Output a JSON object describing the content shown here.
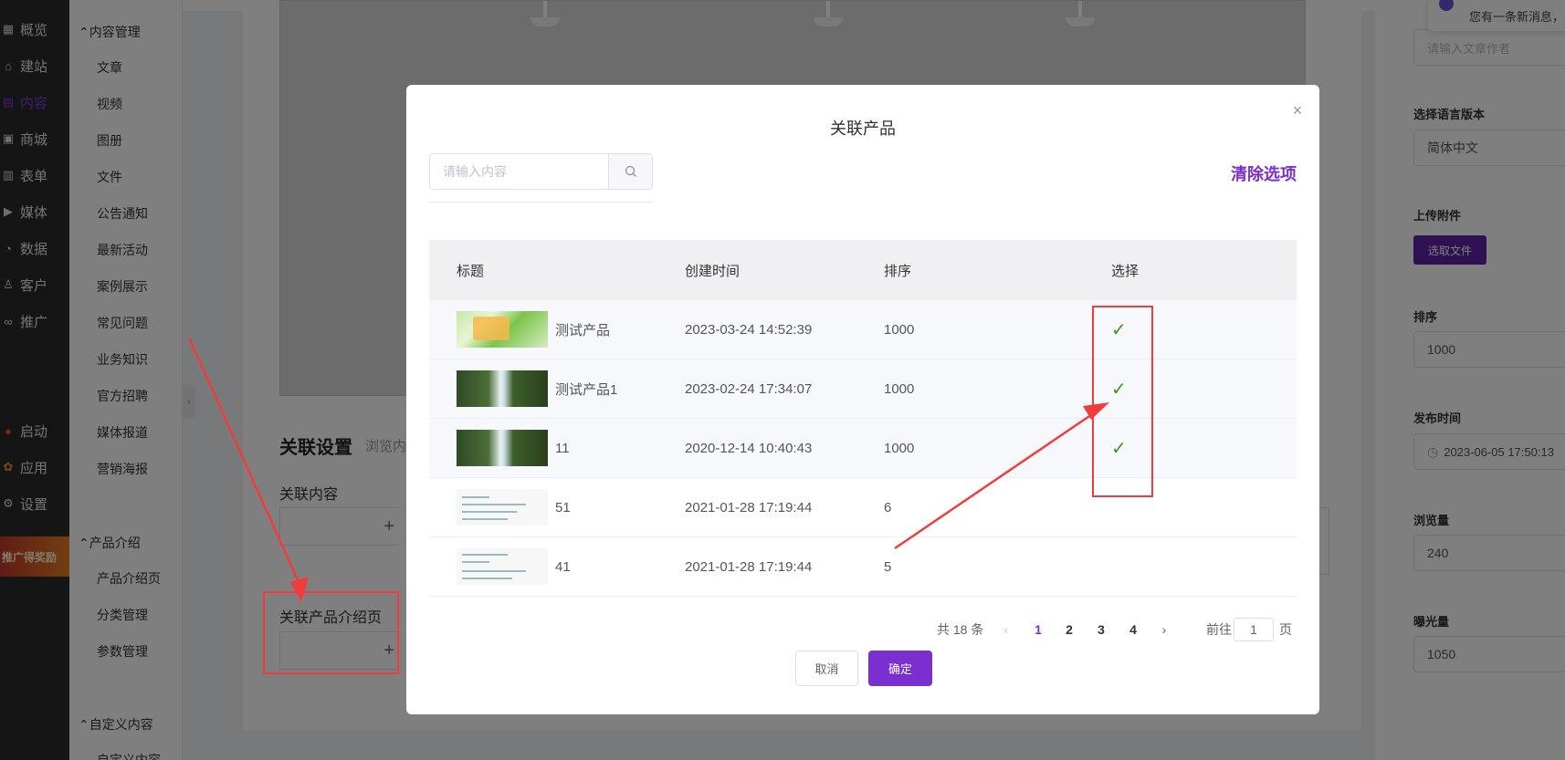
{
  "colors": {
    "accent": "#7b2fd0",
    "sidebar_dark": "#2b2b2d",
    "annotation": "#f03c3c",
    "check": "#3a9a1a"
  },
  "main_nav": {
    "items": [
      {
        "label": "概览",
        "icon": "dashboard-icon"
      },
      {
        "label": "建站",
        "icon": "home-icon"
      },
      {
        "label": "内容",
        "icon": "document-icon",
        "active": true
      },
      {
        "label": "商城",
        "icon": "shop-icon"
      },
      {
        "label": "表单",
        "icon": "form-icon"
      },
      {
        "label": "媒体",
        "icon": "media-icon"
      },
      {
        "label": "数据",
        "icon": "chart-icon"
      },
      {
        "label": "客户",
        "icon": "user-icon"
      },
      {
        "label": "推广",
        "icon": "link-icon"
      }
    ],
    "bottom_items": [
      {
        "label": "启动",
        "icon": "launch-icon"
      },
      {
        "label": "应用",
        "icon": "apps-icon"
      },
      {
        "label": "设置",
        "icon": "gear-icon"
      }
    ],
    "promo": "推广得奖励"
  },
  "sub_nav": {
    "content_group": "内容管理",
    "content_items": [
      "文章",
      "视频",
      "图册",
      "文件",
      "公告通知",
      "最新活动",
      "案例展示",
      "常见问题",
      "业务知识",
      "官方招聘",
      "媒体报道",
      "营销海报"
    ],
    "product_group": "产品介绍",
    "product_items": [
      "产品介绍页",
      "分类管理",
      "参数管理"
    ],
    "custom_group": "自定义内容",
    "custom_items": [
      "自定义内容"
    ]
  },
  "editor": {
    "section_title": "关联设置",
    "section_desc": "浏览内",
    "related_content_label": "关联内容",
    "related_product_label": "关联产品介绍页"
  },
  "right_panel": {
    "author_placeholder": "请输入文章作者",
    "lang_label": "选择语言版本",
    "lang_value": "简体中文",
    "attach_label": "上传附件",
    "attach_button": "选取文件",
    "sort_label": "排序",
    "sort_value": "1000",
    "publish_label": "发布时间",
    "publish_value": "2023-06-05 17:50:13",
    "views_label": "浏览量",
    "views_value": "240",
    "exposure_label": "曝光量",
    "exposure_value": "1050",
    "notification": "您有一条新消息，"
  },
  "dialog": {
    "title": "关联产品",
    "search_placeholder": "请输入内容",
    "clear_label": "清除选项",
    "columns": [
      "标题",
      "创建时间",
      "排序",
      "选择"
    ],
    "rows": [
      {
        "title": "测试产品",
        "created": "2023-03-24 14:52:39",
        "sort": "1000",
        "selected": true,
        "thumb": "green"
      },
      {
        "title": "测试产品1",
        "created": "2023-02-24 17:34:07",
        "sort": "1000",
        "selected": true,
        "thumb": "forest"
      },
      {
        "title": "11",
        "created": "2020-12-14 10:40:43",
        "sort": "1000",
        "selected": true,
        "thumb": "forest"
      },
      {
        "title": "51",
        "created": "2021-01-28 17:19:44",
        "sort": "6",
        "selected": false,
        "thumb": "doc"
      },
      {
        "title": "41",
        "created": "2021-01-28 17:19:44",
        "sort": "5",
        "selected": false,
        "thumb": "doc"
      }
    ],
    "pagination": {
      "total_text": "共 18 条",
      "pages": [
        "1",
        "2",
        "3",
        "4"
      ],
      "current": "1",
      "goto_prefix": "前往",
      "goto_value": "1",
      "goto_suffix": "页"
    },
    "cancel_label": "取消",
    "confirm_label": "确定"
  }
}
